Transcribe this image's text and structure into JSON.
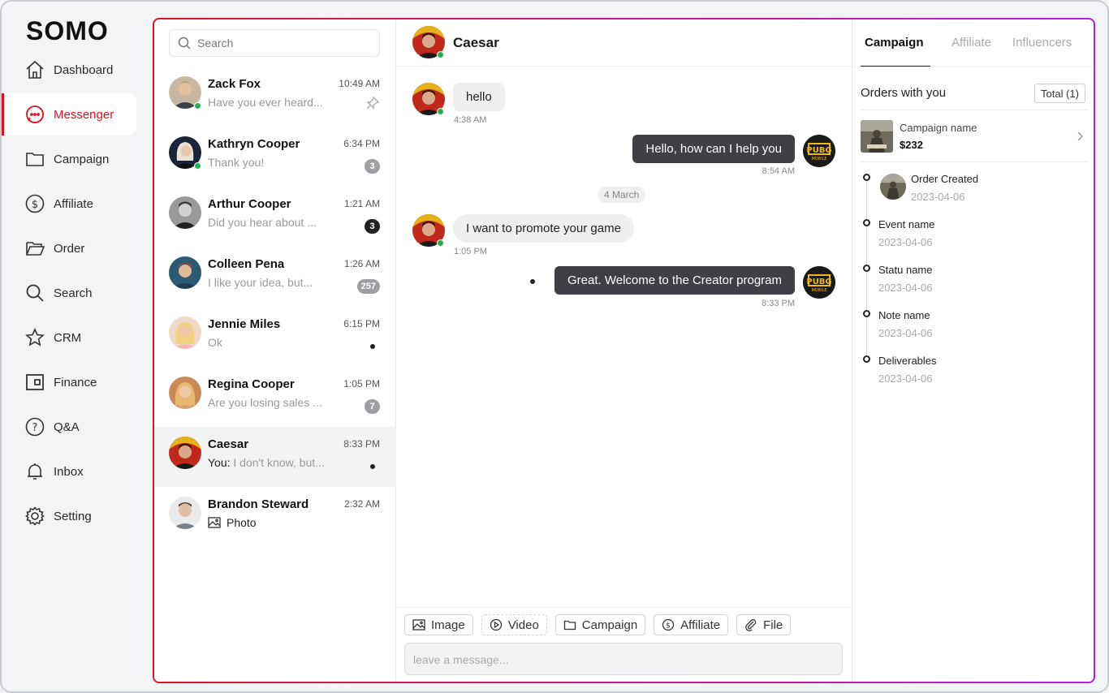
{
  "app": {
    "logo": "SOMO"
  },
  "nav": [
    {
      "label": "Dashboard",
      "icon": "home-icon"
    },
    {
      "label": "Messenger",
      "icon": "chat-bubble-icon",
      "active": true
    },
    {
      "label": "Campaign",
      "icon": "folder-icon"
    },
    {
      "label": "Affiliate",
      "icon": "dollar-circle-icon"
    },
    {
      "label": "Order",
      "icon": "folder-open-icon"
    },
    {
      "label": "Search",
      "icon": "search-icon"
    },
    {
      "label": "CRM",
      "icon": "star-icon"
    },
    {
      "label": "Finance",
      "icon": "wallet-icon"
    },
    {
      "label": "Q&A",
      "icon": "question-circle-icon"
    },
    {
      "label": "Inbox",
      "icon": "bell-icon"
    },
    {
      "label": "Setting",
      "icon": "gear-icon"
    }
  ],
  "search": {
    "placeholder": "Search"
  },
  "conversations": [
    {
      "name": "Zack Fox",
      "time": "10:49 AM",
      "preview": "Have you ever heard...",
      "status": "pin",
      "online": true
    },
    {
      "name": "Kathryn Cooper",
      "time": "6:34 PM",
      "preview": "Thank you!",
      "badge": "3",
      "online": true
    },
    {
      "name": "Arthur Cooper",
      "time": "1:21 AM",
      "preview": "Did you hear about ...",
      "badge": "3",
      "badge_dark": true
    },
    {
      "name": "Colleen Pena",
      "time": "1:26 AM",
      "preview": "I like your idea, but...",
      "badge": "257"
    },
    {
      "name": "Jennie Miles",
      "time": "6:15 PM",
      "preview": "Ok",
      "status": "dot"
    },
    {
      "name": "Regina Cooper",
      "time": "1:05 PM",
      "preview": "Are you losing sales ...",
      "badge": "7"
    },
    {
      "name": "Caesar",
      "time": "8:33 PM",
      "prefix": "You:",
      "preview": "I don't know, but...",
      "status": "dot",
      "active": true
    },
    {
      "name": "Brandon Steward",
      "time": "2:32 AM",
      "preview": "Photo",
      "photo": true
    }
  ],
  "chat": {
    "title": "Caesar",
    "messages": [
      {
        "dir": "in",
        "text": "hello",
        "time": "4:38 AM"
      },
      {
        "dir": "out",
        "text": "Hello, how can I help you",
        "time": "8:54 AM"
      },
      {
        "dir": "date",
        "text": "4 March"
      },
      {
        "dir": "in",
        "text": "I want to promote your game",
        "time": "1:05 PM"
      },
      {
        "dir": "out",
        "text": "Great. Welcome to the Creator program",
        "time": "8:33 PM"
      }
    ],
    "tools": [
      {
        "label": "Image",
        "icon": "image-icon"
      },
      {
        "label": "Video",
        "icon": "play-circle-icon"
      },
      {
        "label": "Campaign",
        "icon": "folder-icon"
      },
      {
        "label": "Affiliate",
        "icon": "dollar-circle-icon"
      },
      {
        "label": "File",
        "icon": "paperclip-icon"
      }
    ],
    "composer_placeholder": "leave a message..."
  },
  "side": {
    "tabs": [
      "Campaign",
      "Affiliate",
      "Influencers"
    ],
    "orders_heading": "Orders with you",
    "total": "Total (1)",
    "campaign": {
      "name": "Campaign name",
      "price": "$232"
    },
    "timeline": [
      {
        "title": "Order Created",
        "date": "2023-04-06",
        "thumb": true
      },
      {
        "title": "Event name",
        "date": "2023-04-06"
      },
      {
        "title": "Statu name",
        "date": "2023-04-06"
      },
      {
        "title": "Note name",
        "date": "2023-04-06"
      },
      {
        "title": "Deliverables",
        "date": "2023-04-06"
      }
    ]
  },
  "colors": {
    "accent": "#e0101c",
    "gradient_end": "#b020e0",
    "online": "#22b14c",
    "outgoing_bubble": "#3f3f46"
  }
}
